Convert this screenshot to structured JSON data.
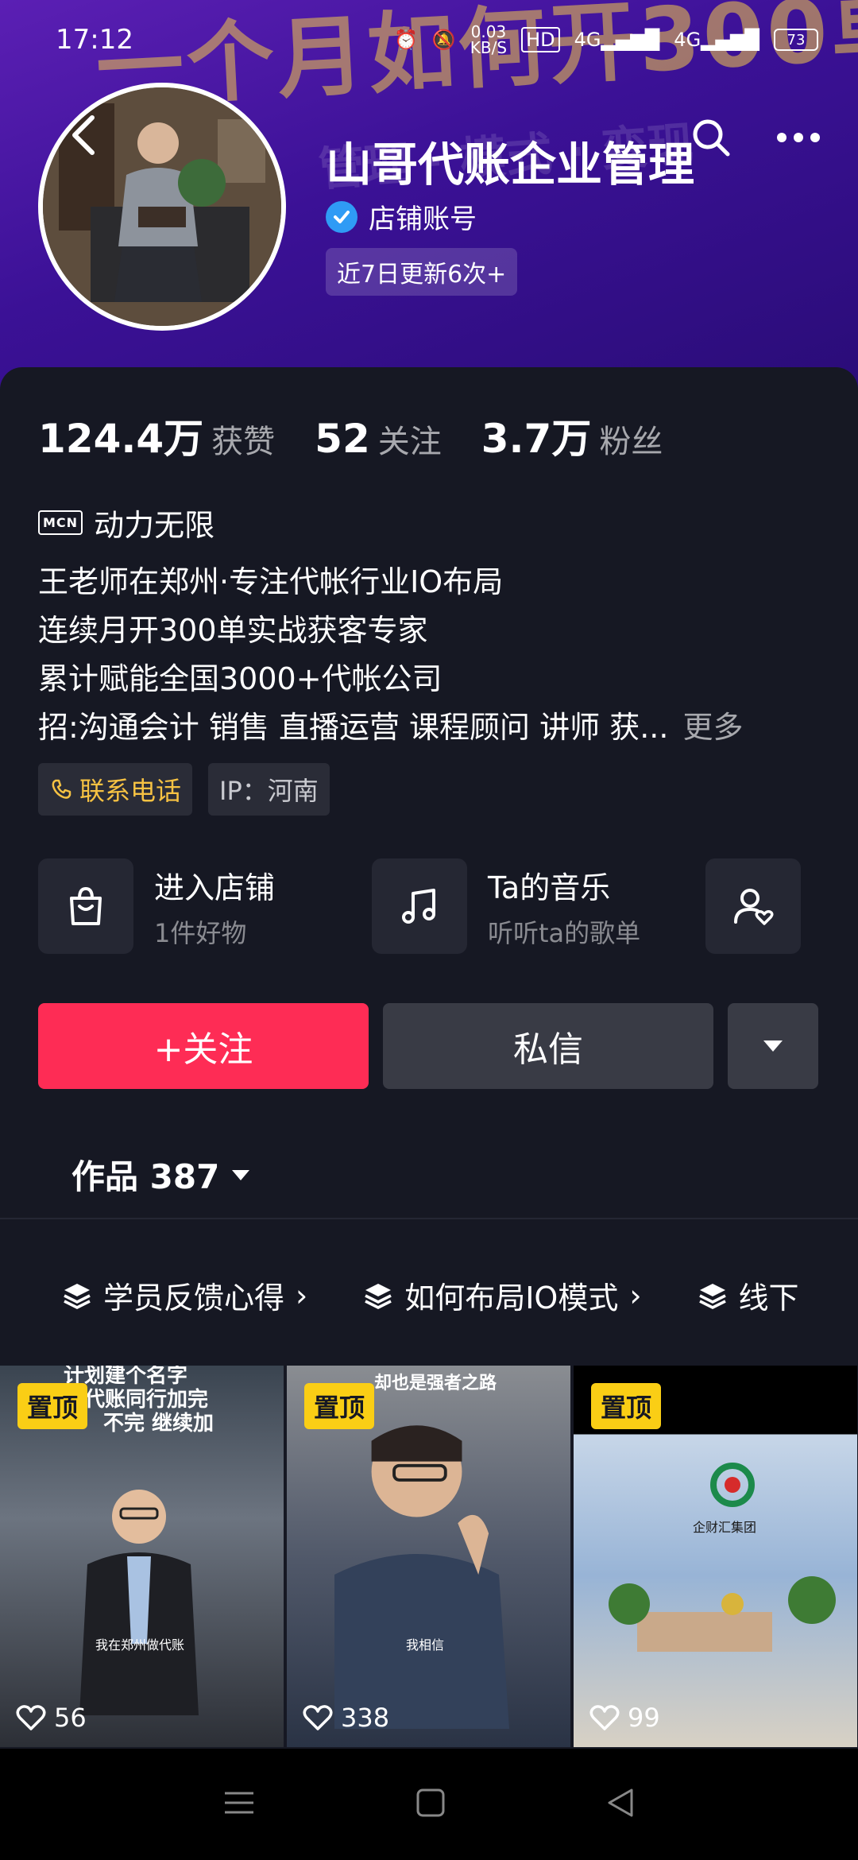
{
  "status_bar": {
    "time": "17:12",
    "net_speed_value": "0.03",
    "net_speed_unit": "KB/S",
    "hd_label": "HD",
    "signal_1": "4G",
    "signal_2": "4G",
    "battery": "73"
  },
  "banner": {
    "bg_text_line1": "一个月如何开300单",
    "bg_text_line2": "管理 · 模式 · 变现"
  },
  "profile": {
    "name": "山哥代账企业管理",
    "badge": "店铺账号",
    "update_chip": "近7日更新6次+"
  },
  "stats": [
    {
      "num": "124.4万",
      "label": "获赞"
    },
    {
      "num": "52",
      "label": "关注"
    },
    {
      "num": "3.7万",
      "label": "粉丝"
    }
  ],
  "mcn": {
    "tag": "MCN",
    "name": "动力无限"
  },
  "bio": {
    "lines": [
      "王老师在郑州·专注代帐行业IO布局",
      "连续月开300单实战获客专家",
      "累计赋能全国3000+代帐公司",
      "招:沟通会计 销售 直播运营 课程顾问 讲师 获..."
    ],
    "more": "更多"
  },
  "tags": {
    "phone": "联系电话",
    "ip": "IP：河南"
  },
  "entries": [
    {
      "title": "进入店铺",
      "sub": "1件好物",
      "icon": "shopping-bag-icon"
    },
    {
      "title": "Ta的音乐",
      "sub": "听听ta的歌单",
      "icon": "music-note-icon"
    },
    {
      "title": "",
      "sub": "",
      "icon": "user-heart-icon"
    }
  ],
  "buttons": {
    "follow": "+关注",
    "message": "私信"
  },
  "works": {
    "label": "作品 387"
  },
  "collections": [
    "学员反馈心得",
    "如何布局IO模式",
    "线下"
  ],
  "videos": [
    {
      "pinned": "置顶",
      "likes": "56",
      "caption_1": "计划建个名字",
      "caption_2": "把代账同行加完",
      "caption_3": "不完 继续加",
      "sub": "我在郑州做代账"
    },
    {
      "pinned": "置顶",
      "likes": "338",
      "caption_1": "却也是强者之路",
      "sub": "我相信"
    },
    {
      "pinned": "置顶",
      "likes": "99",
      "sign": "企财汇集团"
    }
  ],
  "colors": {
    "background": "#161823",
    "follow": "#fe2c55",
    "pin": "#face15",
    "verify": "#2f9bf5",
    "phone_tag": "#f6c243"
  }
}
